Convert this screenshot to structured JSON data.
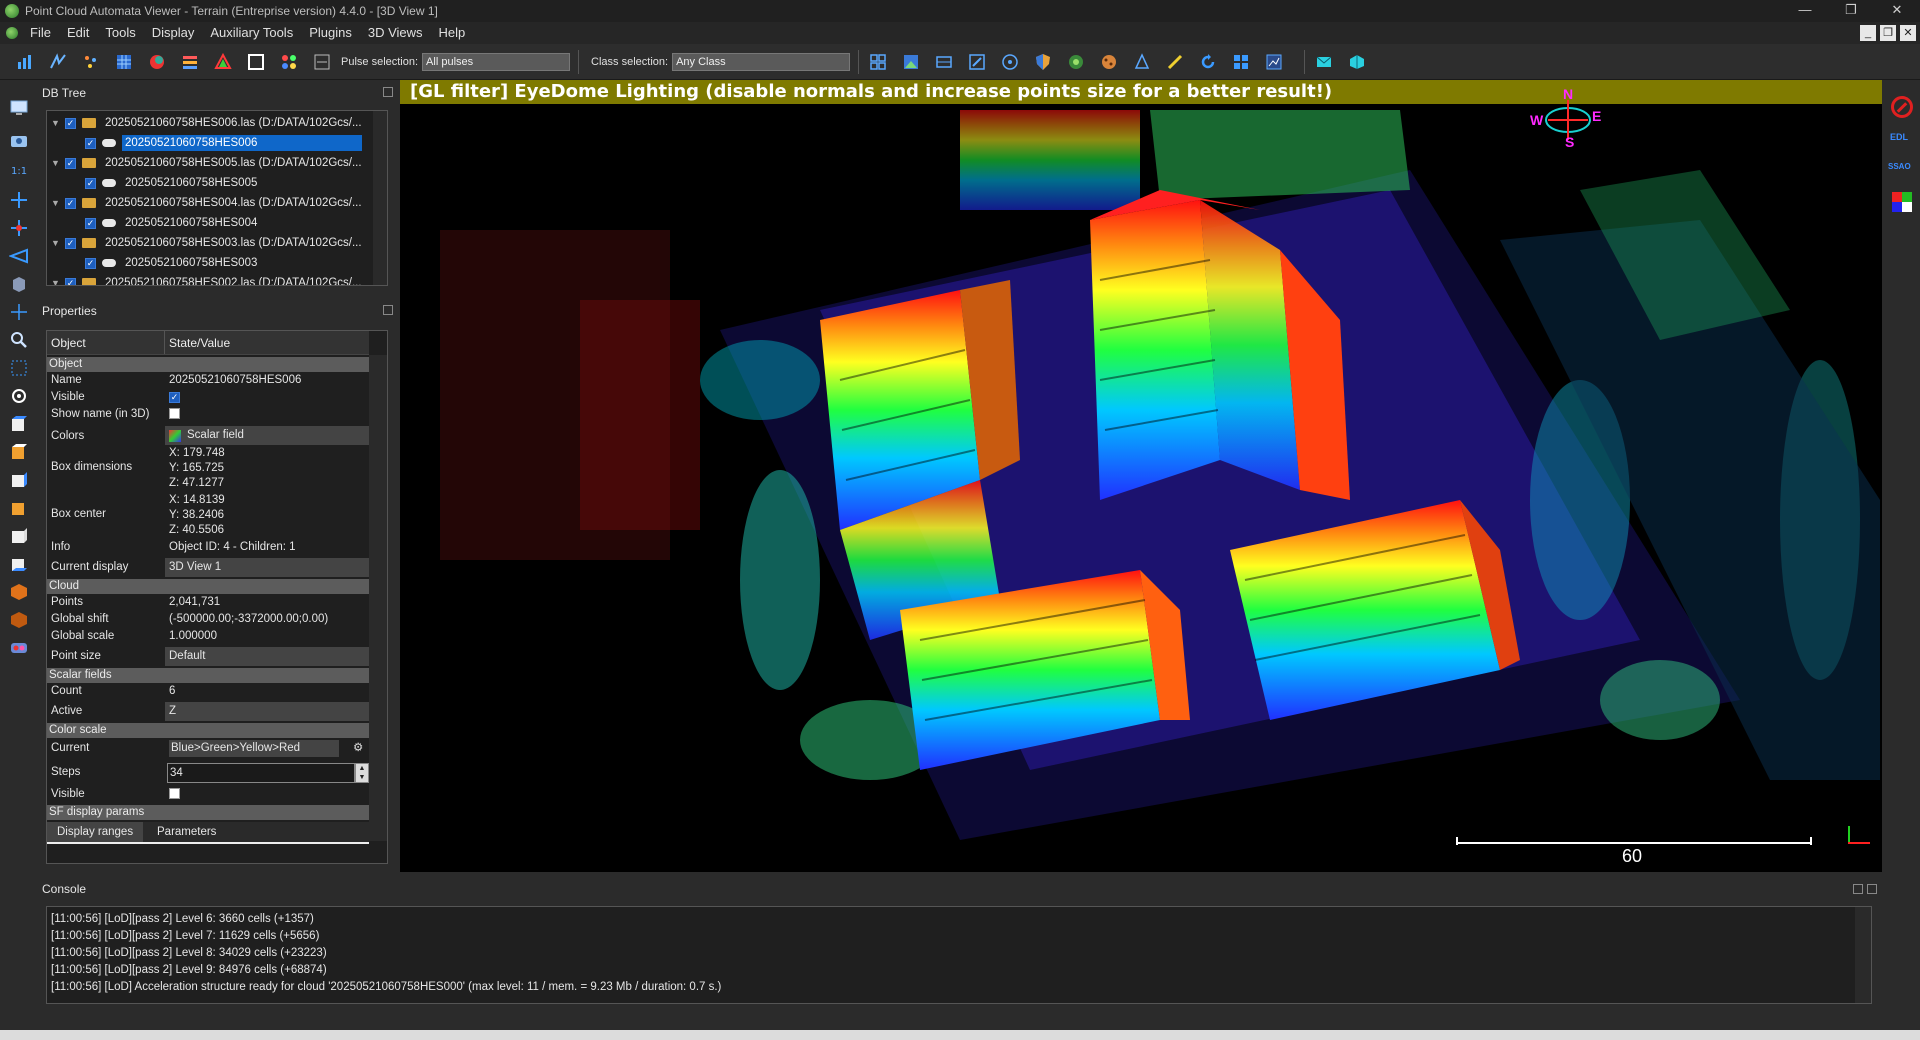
{
  "window": {
    "title": "Point Cloud Automata Viewer - Terrain (Entreprise version) 4.4.0 - [3D View 1]",
    "controls": [
      "—",
      "❐",
      "✕"
    ]
  },
  "menu": [
    "File",
    "Edit",
    "Tools",
    "Display",
    "Auxiliary Tools",
    "Plugins",
    "3D Views",
    "Help"
  ],
  "mdi_controls": [
    "_",
    "❐",
    "✕"
  ],
  "toolbar": {
    "pulse_label": "Pulse selection:",
    "pulse_value": "All pulses",
    "class_label": "Class selection:",
    "class_value": "Any Class"
  },
  "db_tree": {
    "title": "DB Tree",
    "rows": [
      {
        "label": "20250521060758HES006.las (D:/DATA/102Gcs/...",
        "level": 0,
        "selected": false
      },
      {
        "label": "20250521060758HES006",
        "level": 1,
        "selected": true
      },
      {
        "label": "20250521060758HES005.las (D:/DATA/102Gcs/...",
        "level": 0,
        "selected": false
      },
      {
        "label": "20250521060758HES005",
        "level": 1,
        "selected": false
      },
      {
        "label": "20250521060758HES004.las (D:/DATA/102Gcs/...",
        "level": 0,
        "selected": false
      },
      {
        "label": "20250521060758HES004",
        "level": 1,
        "selected": false
      },
      {
        "label": "20250521060758HES003.las (D:/DATA/102Gcs/...",
        "level": 0,
        "selected": false
      },
      {
        "label": "20250521060758HES003",
        "level": 1,
        "selected": false
      },
      {
        "label": "20250521060758HES002.las (D:/DATA/102Gcs/...",
        "level": 0,
        "selected": false
      }
    ]
  },
  "properties": {
    "title": "Properties",
    "col_object": "Object",
    "col_value": "State/Value",
    "sec_object": "Object",
    "name_k": "Name",
    "name_v": "20250521060758HES006",
    "visible_k": "Visible",
    "showname_k": "Show name (in 3D)",
    "colors_k": "Colors",
    "colors_v": "Scalar field",
    "boxdim_k": "Box dimensions",
    "boxdim_x": "X: 179.748",
    "boxdim_y": "Y: 165.725",
    "boxdim_z": "Z: 47.1277",
    "boxcenter_k": "Box center",
    "boxcenter_x": "X: 14.8139",
    "boxcenter_y": "Y: 38.2406",
    "boxcenter_z": "Z: 40.5506",
    "info_k": "Info",
    "info_v": "Object ID: 4 - Children: 1",
    "display_k": "Current display",
    "display_v": "3D View 1",
    "sec_cloud": "Cloud",
    "points_k": "Points",
    "points_v": "2,041,731",
    "shift_k": "Global shift",
    "shift_v": "(-500000.00;-3372000.00;0.00)",
    "scale_k": "Global scale",
    "scale_v": "1.000000",
    "psize_k": "Point size",
    "psize_v": "Default",
    "sec_sf": "Scalar fields",
    "count_k": "Count",
    "count_v": "6",
    "active_k": "Active",
    "active_v": "Z",
    "sec_cs": "Color scale",
    "current_k": "Current",
    "current_v": "Blue>Green>Yellow>Red",
    "steps_k": "Steps",
    "steps_v": "34",
    "visible2_k": "Visible",
    "sec_sfdp": "SF display params",
    "tab_ranges": "Display ranges",
    "tab_params": "Parameters"
  },
  "viewport": {
    "banner": "[GL filter] EyeDome Lighting (disable normals and increase points size for a better result!)",
    "compass": {
      "n": "N",
      "e": "E",
      "s": "S",
      "w": "W"
    },
    "scale_value": "60",
    "right_labels": {
      "edl": "EDL",
      "ssao": "SSAO"
    }
  },
  "console": {
    "title": "Console",
    "lines": [
      "[11:00:56] [LoD][pass 2] Level 6: 3660 cells (+1357)",
      "[11:00:56] [LoD][pass 2] Level 7: 11629 cells (+5656)",
      "[11:00:56] [LoD][pass 2] Level 8: 34029 cells (+23223)",
      "[11:00:56] [LoD][pass 2] Level 9: 84976 cells (+68874)",
      "[11:00:56] [LoD] Acceleration structure ready for cloud '20250521060758HES000' (max level: 11 / mem. = 9.23 Mb / duration: 0.7 s.)"
    ]
  },
  "colors": {
    "banner": "#7f7a00",
    "selection": "#0f67c9",
    "section": "#5c5c5c"
  }
}
